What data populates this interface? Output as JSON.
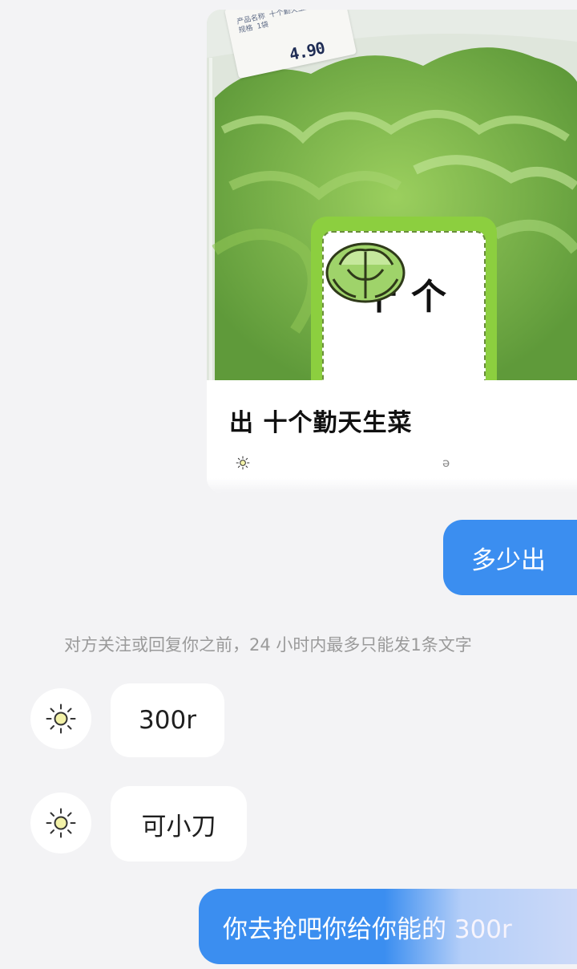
{
  "product_card": {
    "price_tag": {
      "lines": [
        "产品名称 十个勤天生菜",
        "规格 1袋"
      ],
      "price": "4.90"
    },
    "package_label": "十个",
    "title": "出 十个勤天生菜",
    "sub_icon": "sun-icon",
    "sub_trailing": "ə"
  },
  "messages": [
    {
      "side": "out",
      "text": "多少出"
    },
    {
      "side": "system",
      "text": "对方关注或回复你之前，24 小时内最多只能发1条文字"
    },
    {
      "side": "in",
      "text": "300r",
      "avatar_icon": "sun-icon"
    },
    {
      "side": "in",
      "text": "可小刀",
      "avatar_icon": "sun-icon"
    },
    {
      "side": "out",
      "text": "你去抢吧你给你能的 300r"
    }
  ],
  "colors": {
    "background": "#f3f3f5",
    "outgoing_bubble": "#3b8ef0",
    "incoming_bubble": "#ffffff",
    "notice_text": "#9a9a9a",
    "label_green": "#8ccf3f"
  }
}
